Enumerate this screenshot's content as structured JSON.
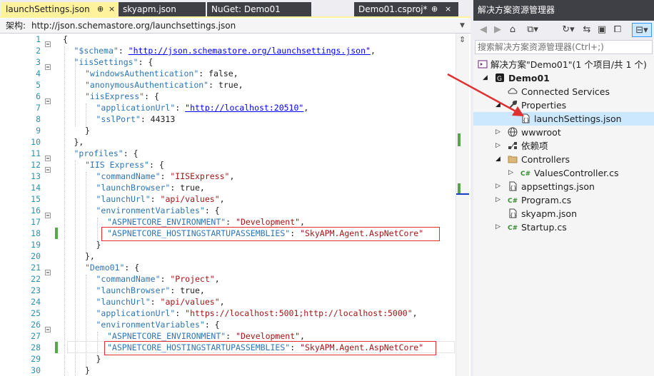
{
  "tabs": [
    {
      "label": "launchSettings.json",
      "pin": "⊕",
      "close": "×"
    },
    {
      "label": "skyapm.json"
    },
    {
      "label": "NuGet: Demo01"
    },
    {
      "label": "Demo01.csproj*",
      "pin": "⊕",
      "close": "×"
    }
  ],
  "schema": {
    "label": "架构:",
    "value": "http://json.schemastore.org/launchsettings.json"
  },
  "code_lines": [
    {
      "n": "1",
      "parts": [
        [
          "p",
          "{"
        ]
      ]
    },
    {
      "n": "2",
      "parts": [
        [
          "k",
          "\"$schema\""
        ],
        [
          "p",
          ": "
        ],
        [
          "u",
          "\"http://json.schemastore.org/launchsettings.json\""
        ],
        [
          "p",
          ","
        ]
      ]
    },
    {
      "n": "3",
      "parts": [
        [
          "k",
          "\"iisSettings\""
        ],
        [
          "p",
          ": {"
        ]
      ]
    },
    {
      "n": "4",
      "parts": [
        [
          "k",
          "\"windowsAuthentication\""
        ],
        [
          "p",
          ": false,"
        ]
      ]
    },
    {
      "n": "5",
      "parts": [
        [
          "k",
          "\"anonymousAuthentication\""
        ],
        [
          "p",
          ": true,"
        ]
      ]
    },
    {
      "n": "6",
      "parts": [
        [
          "k",
          "\"iisExpress\""
        ],
        [
          "p",
          ": {"
        ]
      ]
    },
    {
      "n": "7",
      "parts": [
        [
          "k",
          "\"applicationUrl\""
        ],
        [
          "p",
          ": "
        ],
        [
          "u",
          "\"http://localhost:20510\""
        ],
        [
          "p",
          ","
        ]
      ]
    },
    {
      "n": "8",
      "parts": [
        [
          "k",
          "\"sslPort\""
        ],
        [
          "p",
          ": 44313"
        ]
      ]
    },
    {
      "n": "9",
      "parts": [
        [
          "p",
          "}"
        ]
      ]
    },
    {
      "n": "10",
      "parts": [
        [
          "p",
          "},"
        ]
      ]
    },
    {
      "n": "11",
      "parts": [
        [
          "k",
          "\"profiles\""
        ],
        [
          "p",
          ": {"
        ]
      ]
    },
    {
      "n": "12",
      "parts": [
        [
          "k",
          "\"IIS Express\""
        ],
        [
          "p",
          ": {"
        ]
      ]
    },
    {
      "n": "13",
      "parts": [
        [
          "k",
          "\"commandName\""
        ],
        [
          "p",
          ": "
        ],
        [
          "s",
          "\"IISExpress\""
        ],
        [
          "p",
          ","
        ]
      ]
    },
    {
      "n": "14",
      "parts": [
        [
          "k",
          "\"launchBrowser\""
        ],
        [
          "p",
          ": true,"
        ]
      ]
    },
    {
      "n": "15",
      "parts": [
        [
          "k",
          "\"launchUrl\""
        ],
        [
          "p",
          ": "
        ],
        [
          "s",
          "\"api/values\""
        ],
        [
          "p",
          ","
        ]
      ]
    },
    {
      "n": "16",
      "parts": [
        [
          "k",
          "\"environmentVariables\""
        ],
        [
          "p",
          ": {"
        ]
      ]
    },
    {
      "n": "17",
      "parts": [
        [
          "k",
          "\"ASPNETCORE_ENVIRONMENT\""
        ],
        [
          "p",
          ": "
        ],
        [
          "s",
          "\"Development\""
        ],
        [
          "p",
          ","
        ]
      ]
    },
    {
      "n": "18",
      "parts": [
        [
          "k",
          "\"ASPNETCORE_HOSTINGSTARTUPASSEMBLIES\""
        ],
        [
          "p",
          ": "
        ],
        [
          "s",
          "\"SkyAPM.Agent.AspNetCore\""
        ]
      ]
    },
    {
      "n": "19",
      "parts": [
        [
          "p",
          "}"
        ]
      ]
    },
    {
      "n": "20",
      "parts": [
        [
          "p",
          "},"
        ]
      ]
    },
    {
      "n": "21",
      "parts": [
        [
          "k",
          "\"Demo01\""
        ],
        [
          "p",
          ": {"
        ]
      ]
    },
    {
      "n": "22",
      "parts": [
        [
          "k",
          "\"commandName\""
        ],
        [
          "p",
          ": "
        ],
        [
          "s",
          "\"Project\""
        ],
        [
          "p",
          ","
        ]
      ]
    },
    {
      "n": "23",
      "parts": [
        [
          "k",
          "\"launchBrowser\""
        ],
        [
          "p",
          ": true,"
        ]
      ]
    },
    {
      "n": "24",
      "parts": [
        [
          "k",
          "\"launchUrl\""
        ],
        [
          "p",
          ": "
        ],
        [
          "s",
          "\"api/values\""
        ],
        [
          "p",
          ","
        ]
      ]
    },
    {
      "n": "25",
      "parts": [
        [
          "k",
          "\"applicationUrl\""
        ],
        [
          "p",
          ": "
        ],
        [
          "s",
          "\"https://localhost:5001;http://localhost:5000\""
        ],
        [
          "p",
          ","
        ]
      ]
    },
    {
      "n": "26",
      "parts": [
        [
          "k",
          "\"environmentVariables\""
        ],
        [
          "p",
          ": {"
        ]
      ]
    },
    {
      "n": "27",
      "parts": [
        [
          "k",
          "\"ASPNETCORE_ENVIRONMENT\""
        ],
        [
          "p",
          ": "
        ],
        [
          "s",
          "\"Development\""
        ],
        [
          "p",
          ","
        ]
      ]
    },
    {
      "n": "28",
      "parts": [
        [
          "k",
          "\"ASPNETCORE_HOSTINGSTARTUPASSEMBLIES\""
        ],
        [
          "p",
          ": "
        ],
        [
          "s",
          "\"SkyAPM.Agent.AspNetCore\""
        ]
      ]
    },
    {
      "n": "29",
      "parts": [
        [
          "p",
          "}"
        ]
      ]
    },
    {
      "n": "30",
      "parts": [
        [
          "p",
          "}"
        ]
      ]
    }
  ],
  "panel": {
    "title": "解决方案资源管理器",
    "search_placeholder": "搜索解决方案资源管理器(Ctrl+;)",
    "tree": [
      {
        "label": "解决方案\"Demo01\"(1 个项目/共 1 个)",
        "icon": "solution-icon",
        "expander": ""
      },
      {
        "label": "Demo01",
        "icon": "csharp-project-icon",
        "expander": "◢",
        "bold": true
      },
      {
        "label": "Connected Services",
        "icon": "cloud-icon",
        "expander": ""
      },
      {
        "label": "Properties",
        "icon": "wrench-icon",
        "expander": "◢"
      },
      {
        "label": "launchSettings.json",
        "icon": "json-file-icon",
        "expander": "",
        "selected": true
      },
      {
        "label": "wwwroot",
        "icon": "globe-icon",
        "expander": "▷"
      },
      {
        "label": "依赖项",
        "icon": "dependencies-icon",
        "expander": "▷"
      },
      {
        "label": "Controllers",
        "icon": "folder-icon",
        "expander": "◢"
      },
      {
        "label": "ValuesController.cs",
        "icon": "csharp-file-icon",
        "expander": "▷"
      },
      {
        "label": "appsettings.json",
        "icon": "json-file-icon",
        "expander": "▷"
      },
      {
        "label": "Program.cs",
        "icon": "csharp-file-icon",
        "expander": "▷"
      },
      {
        "label": "skyapm.json",
        "icon": "json-file-icon",
        "expander": ""
      },
      {
        "label": "Startup.cs",
        "icon": "csharp-file-icon",
        "expander": "▷"
      }
    ]
  },
  "colors": {
    "accent": "#1C97EA",
    "annotation_red": "#E03030",
    "change_green": "#57A64A"
  }
}
